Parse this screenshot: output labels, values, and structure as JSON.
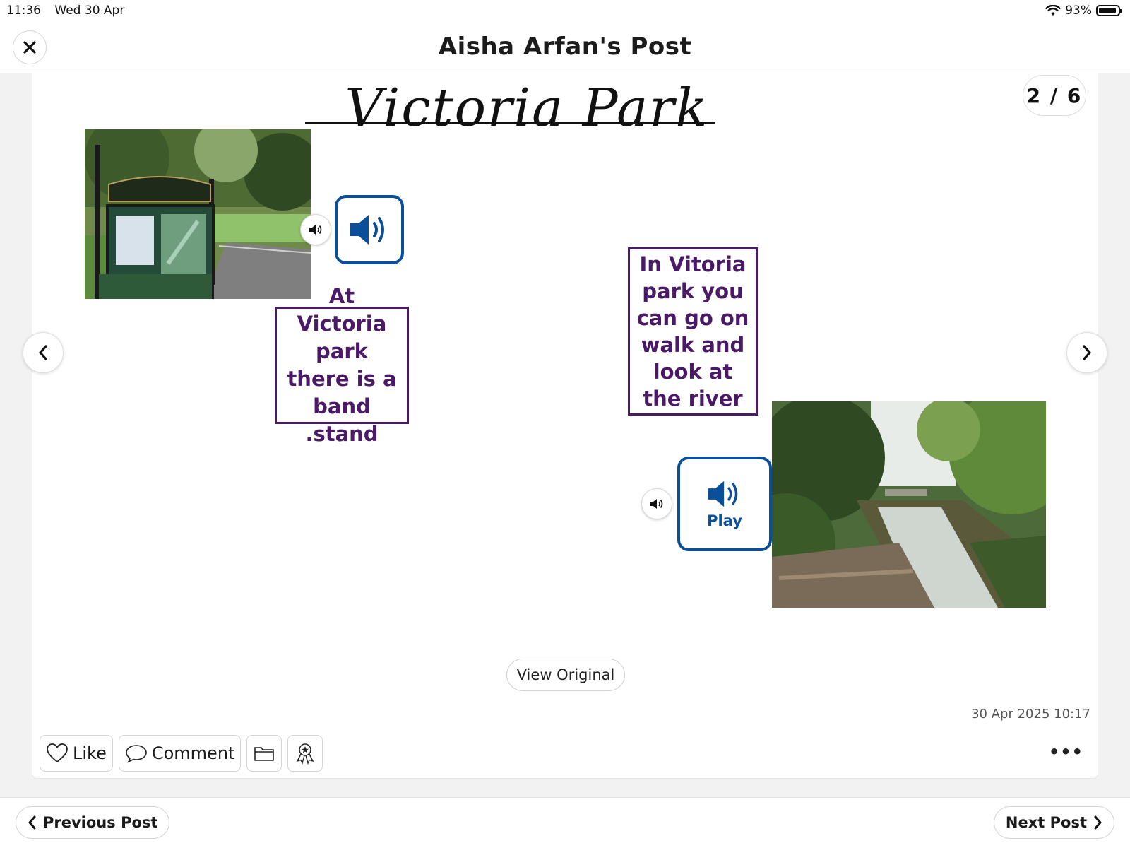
{
  "status_bar": {
    "time": "11:36",
    "date": "Wed 30 Apr",
    "battery": "93%",
    "battery_level": 0.93
  },
  "header": {
    "title": "Aisha Arfan's Post"
  },
  "slide": {
    "title": "Victoria Park",
    "counter": "2 / 6",
    "caption_1": "At Victoria park  there is a band .stand",
    "caption_2": "In Vitoria park you can go on walk and look at the river",
    "play_label": "Play"
  },
  "post": {
    "view_original": "View Original",
    "timestamp": "30 Apr 2025 10:17",
    "like_label": "Like",
    "comment_label": "Comment",
    "more": "•••"
  },
  "footer": {
    "previous": "Previous Post",
    "next": "Next Post"
  },
  "icons": {
    "close": "close-icon",
    "wifi": "wifi-icon",
    "battery": "battery-icon",
    "speaker": "speaker-icon",
    "heart": "heart-icon",
    "comment": "comment-bubble-icon",
    "folder": "folder-icon",
    "award": "award-icon",
    "chevron_left": "chevron-left-icon",
    "chevron_right": "chevron-right-icon"
  },
  "colors": {
    "caption_border": "#4a1a66",
    "audio_blue": "#0b4f9a",
    "background": "#f2f2f2"
  }
}
